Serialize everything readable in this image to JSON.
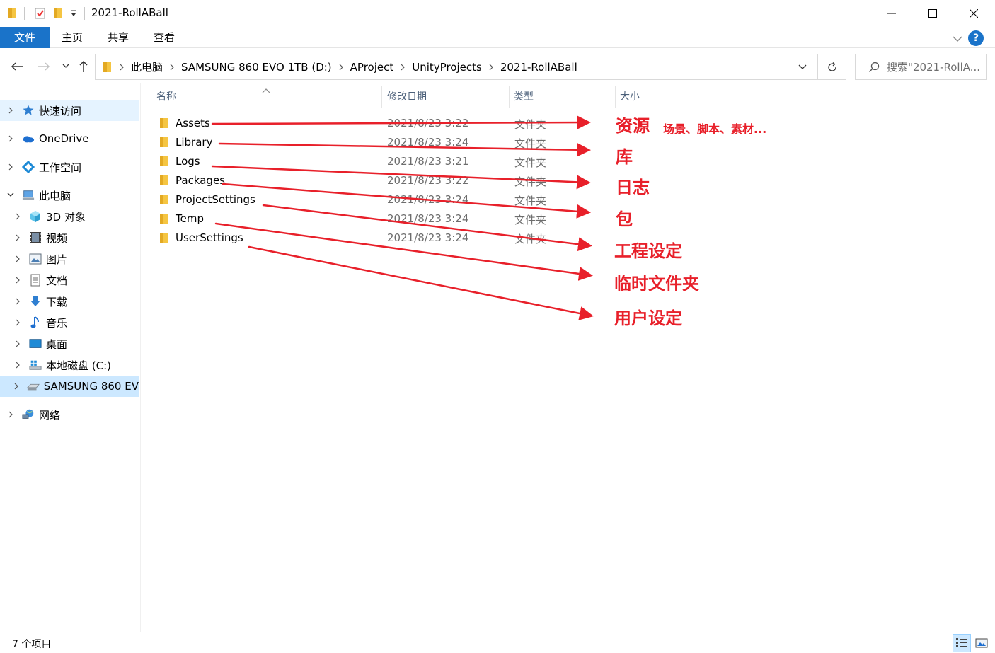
{
  "window": {
    "title": "2021-RollABall",
    "controls": {
      "minimize": "minimize-icon",
      "maximize": "maximize-icon",
      "close": "close-icon"
    }
  },
  "ribbon": {
    "tabs": [
      {
        "label": "文件",
        "active": true
      },
      {
        "label": "主页"
      },
      {
        "label": "共享"
      },
      {
        "label": "查看"
      }
    ],
    "accent": "#1a73c9"
  },
  "address": {
    "crumbs": [
      "此电脑",
      "SAMSUNG 860 EVO 1TB (D:)",
      "AProject",
      "UnityProjects",
      "2021-RollABall"
    ],
    "search_placeholder": "搜索\"2021-RollA..."
  },
  "nav": {
    "items": [
      {
        "label": "快速访问",
        "icon": "star-icon"
      },
      {
        "label": "OneDrive",
        "icon": "cloud-icon"
      },
      {
        "label": "工作空间",
        "icon": "workspace-icon"
      },
      {
        "label": "此电脑",
        "icon": "computer-icon"
      },
      {
        "label": "3D 对象",
        "icon": "cube-icon"
      },
      {
        "label": "视频",
        "icon": "video-icon"
      },
      {
        "label": "图片",
        "icon": "picture-icon"
      },
      {
        "label": "文档",
        "icon": "document-icon"
      },
      {
        "label": "下载",
        "icon": "download-icon"
      },
      {
        "label": "音乐",
        "icon": "music-icon"
      },
      {
        "label": "桌面",
        "icon": "desktop-icon"
      },
      {
        "label": "本地磁盘 (C:)",
        "icon": "windows-drive-icon"
      },
      {
        "label": "SAMSUNG 860 EV",
        "icon": "drive-icon"
      },
      {
        "label": "网络",
        "icon": "network-icon"
      }
    ]
  },
  "columns": {
    "name": "名称",
    "date": "修改日期",
    "type": "类型",
    "size": "大小"
  },
  "files": [
    {
      "name": "Assets",
      "date": "2021/8/23 3:22",
      "type": "文件夹"
    },
    {
      "name": "Library",
      "date": "2021/8/23 3:24",
      "type": "文件夹"
    },
    {
      "name": "Logs",
      "date": "2021/8/23 3:21",
      "type": "文件夹"
    },
    {
      "name": "Packages",
      "date": "2021/8/23 3:22",
      "type": "文件夹"
    },
    {
      "name": "ProjectSettings",
      "date": "2021/8/23 3:24",
      "type": "文件夹"
    },
    {
      "name": "Temp",
      "date": "2021/8/23 3:24",
      "type": "文件夹"
    },
    {
      "name": "UserSettings",
      "date": "2021/8/23 3:24",
      "type": "文件夹"
    }
  ],
  "annotations": {
    "color": "#e8202a",
    "labels": [
      "资源",
      "库",
      "日志",
      "包",
      "工程设定",
      "临时文件夹",
      "用户设定"
    ],
    "assets_note": "场景、脚本、素材..."
  },
  "status": {
    "item_count": "7 个项目"
  }
}
